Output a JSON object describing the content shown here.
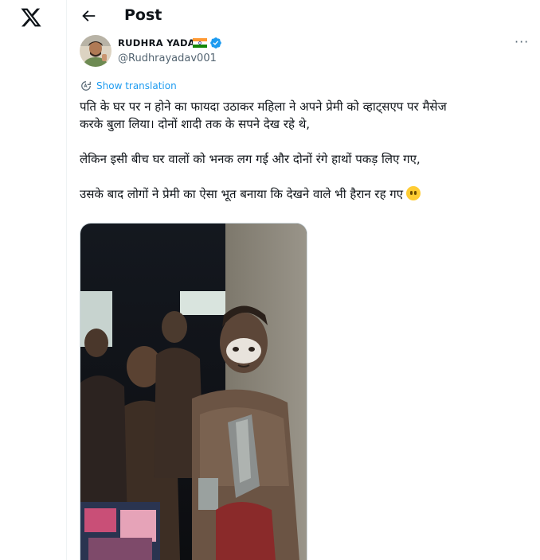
{
  "nav": {
    "logo_icon": "x-logo-icon"
  },
  "header": {
    "title": "Post",
    "back_icon": "arrow-left-icon"
  },
  "author": {
    "name": "RUDHRA YADAV",
    "handle": "@Rudhrayadav001",
    "flag_icon": "india-flag-icon",
    "verified_icon": "verified-badge-icon",
    "verified_color": "#1d9bf0"
  },
  "more_label": "···",
  "translate": {
    "label": "Show translation"
  },
  "tweet": {
    "line1": "पति के घर पर न होने का फायदा उठाकर महिला ने अपने प्रेमी को व्हाट्सएप पर मैसेज",
    "line2": "करके बुला लिया। दोनों शादी तक के सपने देख रहे थे,",
    "line3": "लेकिन इसी बीच घर वालों को भनक लग गई और दोनों रंगे हाथों पकड़ लिए गए,",
    "line4": "उसके बाद लोगों ने प्रेमी का ऐसा भूत बनाया कि देखने वाले भी हैरान रह गए",
    "emoji_icon": "face-without-mouth-emoji"
  },
  "media": {
    "type": "photo"
  }
}
